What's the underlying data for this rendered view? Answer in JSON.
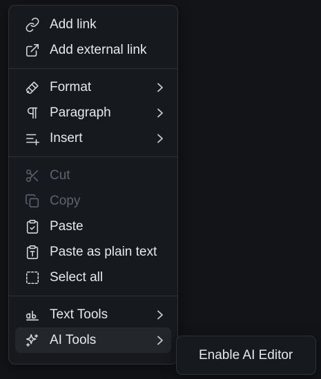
{
  "menu": {
    "groups": [
      [
        {
          "label": "Add link",
          "icon": "link-icon",
          "disabled": false,
          "submenu": false
        },
        {
          "label": "Add external link",
          "icon": "external-link-icon",
          "disabled": false,
          "submenu": false
        }
      ],
      [
        {
          "label": "Format",
          "icon": "paintbrush-icon",
          "disabled": false,
          "submenu": true
        },
        {
          "label": "Paragraph",
          "icon": "pilcrow-icon",
          "disabled": false,
          "submenu": true
        },
        {
          "label": "Insert",
          "icon": "list-plus-icon",
          "disabled": false,
          "submenu": true
        }
      ],
      [
        {
          "label": "Cut",
          "icon": "scissors-icon",
          "disabled": true,
          "submenu": false
        },
        {
          "label": "Copy",
          "icon": "copy-icon",
          "disabled": true,
          "submenu": false
        },
        {
          "label": "Paste",
          "icon": "clipboard-check-icon",
          "disabled": false,
          "submenu": false
        },
        {
          "label": "Paste as plain text",
          "icon": "clipboard-text-icon",
          "disabled": false,
          "submenu": false
        },
        {
          "label": "Select all",
          "icon": "dashed-square-icon",
          "disabled": false,
          "submenu": false
        }
      ],
      [
        {
          "label": "Text Tools",
          "icon": "text-tools-icon",
          "disabled": false,
          "submenu": true
        },
        {
          "label": "AI Tools",
          "icon": "sparkles-icon",
          "disabled": false,
          "submenu": true,
          "active": true
        }
      ]
    ]
  },
  "submenu": {
    "items": [
      {
        "label": "Enable AI Editor"
      }
    ]
  },
  "colors": {
    "background": "#121417",
    "menu_bg": "#16191d",
    "border": "#2e3237",
    "text": "#e7e9ec",
    "disabled_text": "#5f646b",
    "active_bg": "#23272c"
  }
}
